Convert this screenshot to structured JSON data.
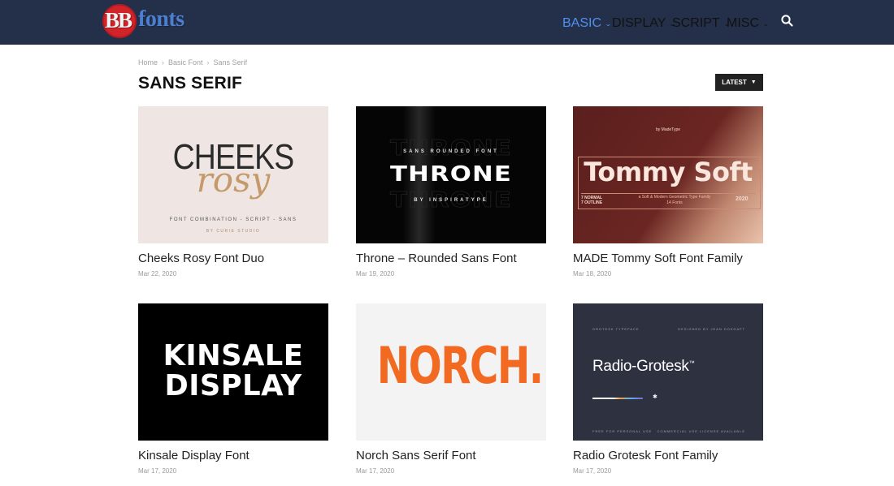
{
  "logo": {
    "bb": "BB",
    "fonts": "fonts"
  },
  "nav": {
    "items": [
      {
        "label": "BASIC",
        "active": true
      },
      {
        "label": "DISPLAY",
        "active": false
      },
      {
        "label": "SCRIPT",
        "active": false
      },
      {
        "label": "MISC",
        "active": false
      }
    ],
    "search_icon": "search-icon"
  },
  "breadcrumb": [
    "Home",
    "Basic Font",
    "Sans Serif"
  ],
  "page_title": "SANS SERIF",
  "sort": {
    "label": "LATEST"
  },
  "colors": {
    "header_bg": "#243049",
    "nav_active": "#4f8ff0",
    "logo_red": "#d3232a",
    "logo_blue": "#4d7fd0"
  },
  "cards": [
    {
      "title": "Cheeks Rosy Font Duo",
      "date": "Mar 22, 2020",
      "thumb": {
        "line1": "CHEEKS",
        "line2": "rosy",
        "line3": "FONT COMBINATION - SCRIPT - SANS",
        "line4": "BY CURIE STUDIO"
      }
    },
    {
      "title": "Throne – Rounded Sans Font",
      "date": "Mar 19, 2020",
      "thumb": {
        "line1": "SANS ROUNDED FONT",
        "line2": "THRONE",
        "line3": "BY INSPIRATYPE"
      }
    },
    {
      "title": "MADE Tommy Soft Font Family",
      "date": "Mar 18, 2020",
      "thumb": {
        "top": "by MadeType",
        "main": "Tommy Soft",
        "left1": "7 NORMAL",
        "left2": "7 OUTLINE",
        "mid1": "a Soft & Modern Geometric Type Family",
        "mid2": "14 Fonts",
        "year": "2020"
      }
    },
    {
      "title": "Kinsale Display Font",
      "date": "Mar 17, 2020",
      "thumb": {
        "line1": "KINSALE",
        "line2": "DISPLAY"
      }
    },
    {
      "title": "Norch Sans Serif Font",
      "date": "Mar 17, 2020",
      "thumb": {
        "main": "NORCH."
      }
    },
    {
      "title": "Radio Grotesk Font Family",
      "date": "Mar 17, 2020",
      "thumb": {
        "tl": "GROTESK TYPEFACE",
        "tr": "DESIGNED BY JEAN DOKHAFT",
        "main": "Radio-Grotesk",
        "tm": "™",
        "bl": "FREE FOR PERSONAL USE",
        "br": "COMMERCIAL USE LICENSE AVAILABLE"
      }
    }
  ]
}
